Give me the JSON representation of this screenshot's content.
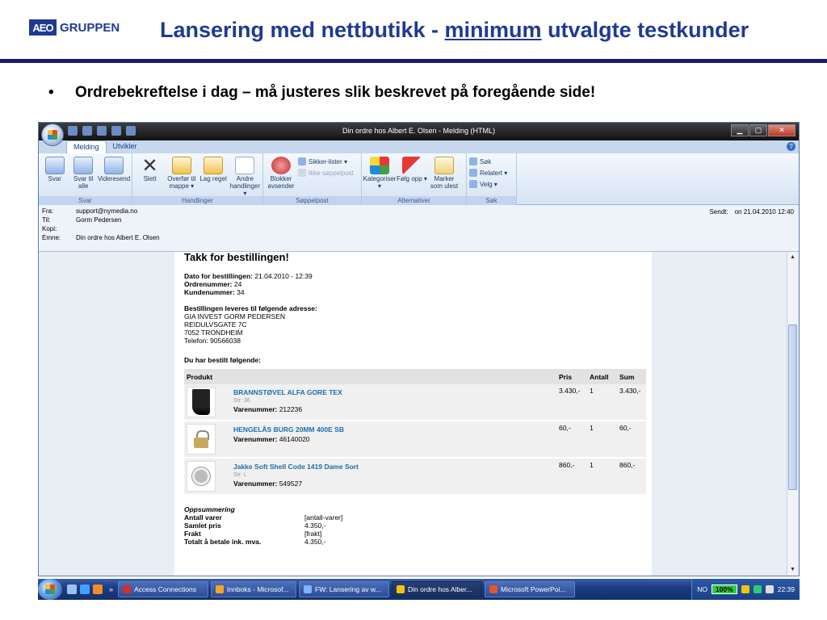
{
  "slide": {
    "logo_box": "AEO",
    "logo_text": "GRUPPEN",
    "title_before": "Lansering med nettbutikk - ",
    "title_underlined": "minimum",
    "title_after": " utvalgte testkunder",
    "bullet_symbol": "•",
    "bullet_text": "Ordrebekreftelse i dag – må justeres slik beskrevet på foregående side!"
  },
  "window": {
    "title": "Din ordre hos Albert E. Olsen - Melding (HTML)",
    "tabs": [
      "Melding",
      "Utvikler"
    ],
    "help": "?",
    "controls": {
      "minimize": "▁",
      "maximize": "▢",
      "close": "✕"
    }
  },
  "ribbon": {
    "groups": [
      {
        "label": "Svar",
        "buttons": [
          "Svar",
          "Svar til alle",
          "Videresend"
        ]
      },
      {
        "label": "Handlinger",
        "buttons": [
          "Slett",
          "Overfør til mappe ▾",
          "Lag regel",
          "Andre handlinger ▾"
        ]
      },
      {
        "label": "Søppelpost",
        "buttons": [
          "Blokker avsender"
        ],
        "small": [
          "Sikker-lister ▾",
          "Ikke søppelpost"
        ]
      },
      {
        "label": "Alternativer",
        "buttons": [
          "Kategoriser ▾",
          "Følg opp ▾",
          "Marker som ulest"
        ]
      },
      {
        "label": "Søk",
        "small": [
          "Søk",
          "Relatert ▾",
          "Velg ▾"
        ]
      }
    ]
  },
  "header": {
    "from_label": "Fra:",
    "from": "support@nymedia.no",
    "to_label": "Til:",
    "to": "Gorm Pedersen",
    "cc_label": "Kopi:",
    "cc": "",
    "subject_label": "Emne:",
    "subject": "Din ordre hos Albert E. Olsen",
    "sent_label": "Sendt:",
    "sent": "on 21.04.2010 12:40"
  },
  "email": {
    "thanks": "Takk for bestillingen!",
    "date_label": "Dato for bestillingen:",
    "date": " 21.04.2010 - 12:39",
    "order_label": "Ordrenummer:",
    "order": " 24",
    "customer_label": "Kundenummer:",
    "customer": " 34",
    "address_heading": "Bestillingen leveres til følgende adresse:",
    "address_lines": [
      "GIA INVEST GORM PEDERSEN",
      "REIDULVSGATE 7C",
      "7052 TRONDHEIM",
      "Telefon: 90566038"
    ],
    "ordered_heading": "Du har bestilt følgende:",
    "columns": [
      "Produkt",
      "Pris",
      "Antall",
      "Sum"
    ],
    "products": [
      {
        "name": "BRANNSTØVEL ALFA GORE TEX",
        "sub": "Str: 36",
        "varenr_label": "Varenummer:",
        "varenr": " 212236",
        "price": "3.430,-",
        "qty": "1",
        "sum": "3.430,-",
        "thumb": "boot"
      },
      {
        "name": "HENGELÅS BURG 20MM 400E SB",
        "sub": "",
        "varenr_label": "Varenummer:",
        "varenr": " 46140020",
        "price": "60,-",
        "qty": "1",
        "sum": "60,-",
        "thumb": "lock"
      },
      {
        "name": "Jakke Soft Shell Code 1419 Dame Sort",
        "sub": "Str: L",
        "varenr_label": "Varenummer:",
        "varenr": " 549527",
        "price": "860,-",
        "qty": "1",
        "sum": "860,-",
        "thumb": "camera"
      }
    ],
    "summary_heading": "Oppsummering",
    "summary": [
      {
        "k": "Antall varer",
        "v": "[antall-varer]"
      },
      {
        "k": "Samlet pris",
        "v": "4.350,-"
      },
      {
        "k": "Frakt",
        "v": "[frakt]"
      },
      {
        "k": "Totalt å betale ink. mva.",
        "v": "4.350,-"
      }
    ]
  },
  "taskbar": {
    "chevron": "»",
    "buttons": [
      {
        "label": "Access Connections",
        "color": "#d32f2f"
      },
      {
        "label": "Innboks - Microsof...",
        "color": "#f5a623"
      },
      {
        "label": "FW: Lansering av w...",
        "color": "#7fb3ff"
      },
      {
        "label": "Din ordre hos Alber...",
        "color": "#f1c40f"
      },
      {
        "label": "Microsoft PowerPoi...",
        "color": "#e2572c"
      }
    ],
    "lang": "NO",
    "battery": "100%",
    "time": "22:39"
  }
}
